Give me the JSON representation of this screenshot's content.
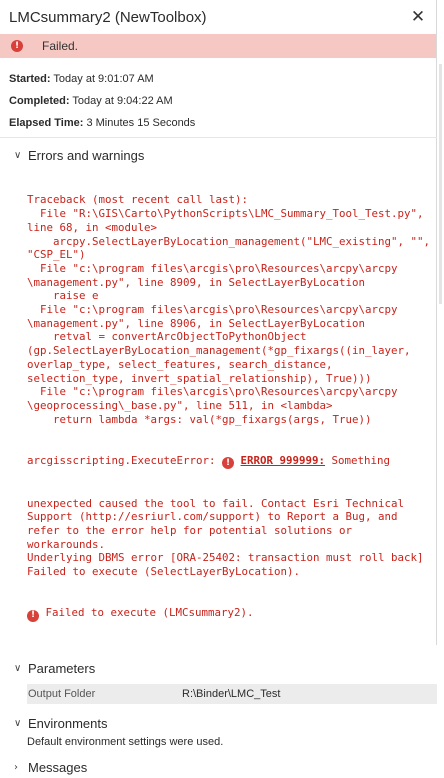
{
  "window": {
    "title": "LMCsummary2 (NewToolbox)"
  },
  "status": {
    "text": "Failed."
  },
  "meta": {
    "started_label": "Started:",
    "started_value": "Today at 9:01:07 AM",
    "completed_label": "Completed:",
    "completed_value": "Today at 9:04:22 AM",
    "elapsed_label": "Elapsed Time:",
    "elapsed_value": "3 Minutes 15 Seconds"
  },
  "errors": {
    "header": "Errors and warnings",
    "lines_before": [
      "Traceback (most recent call last):",
      "  File \"R:\\GIS\\Carto\\PythonScripts\\LMC_Summary_Tool_Test.py\",",
      "line 68, in <module>",
      "    arcpy.SelectLayerByLocation_management(\"LMC_existing\", \"\",",
      "\"CSP_EL\")",
      "  File \"c:\\program files\\arcgis\\pro\\Resources\\arcpy\\arcpy",
      "\\management.py\", line 8909, in SelectLayerByLocation",
      "    raise e",
      "  File \"c:\\program files\\arcgis\\pro\\Resources\\arcpy\\arcpy",
      "\\management.py\", line 8906, in SelectLayerByLocation",
      "    retval = convertArcObjectToPythonObject",
      "(gp.SelectLayerByLocation_management(*gp_fixargs((in_layer,",
      "overlap_type, select_features, search_distance,",
      "selection_type, invert_spatial_relationship), True)))",
      "  File \"c:\\program files\\arcgis\\pro\\Resources\\arcpy\\arcpy",
      "\\geoprocessing\\_base.py\", line 511, in <lambda>",
      "    return lambda *args: val(*gp_fixargs(args, True))"
    ],
    "exec_error_prefix": "arcgisscripting.ExecuteError: ",
    "error_code": "ERROR 999999:",
    "exec_error_suffix": " Something",
    "lines_after": [
      "unexpected caused the tool to fail. Contact Esri Technical",
      "Support (http://esriurl.com/support) to Report a Bug, and",
      "refer to the error help for potential solutions or",
      "workarounds.",
      "Underlying DBMS error [ORA-25402: transaction must roll back]",
      "Failed to execute (SelectLayerByLocation)."
    ],
    "final_line": "Failed to execute (LMCsummary2)."
  },
  "parameters": {
    "header": "Parameters",
    "rows": [
      {
        "key": "Output Folder",
        "value": "R:\\Binder\\LMC_Test"
      }
    ]
  },
  "environments": {
    "header": "Environments",
    "text": "Default environment settings were used."
  },
  "messages": {
    "header": "Messages"
  },
  "icons": {
    "error": "error-circle-icon",
    "close": "close-icon",
    "chevron_expanded": "chevron-down-icon",
    "chevron_collapsed": "chevron-right-icon"
  },
  "colors": {
    "banner": "#f5c8c4",
    "error_red": "#c8231b",
    "error_dot": "#d8403a"
  }
}
